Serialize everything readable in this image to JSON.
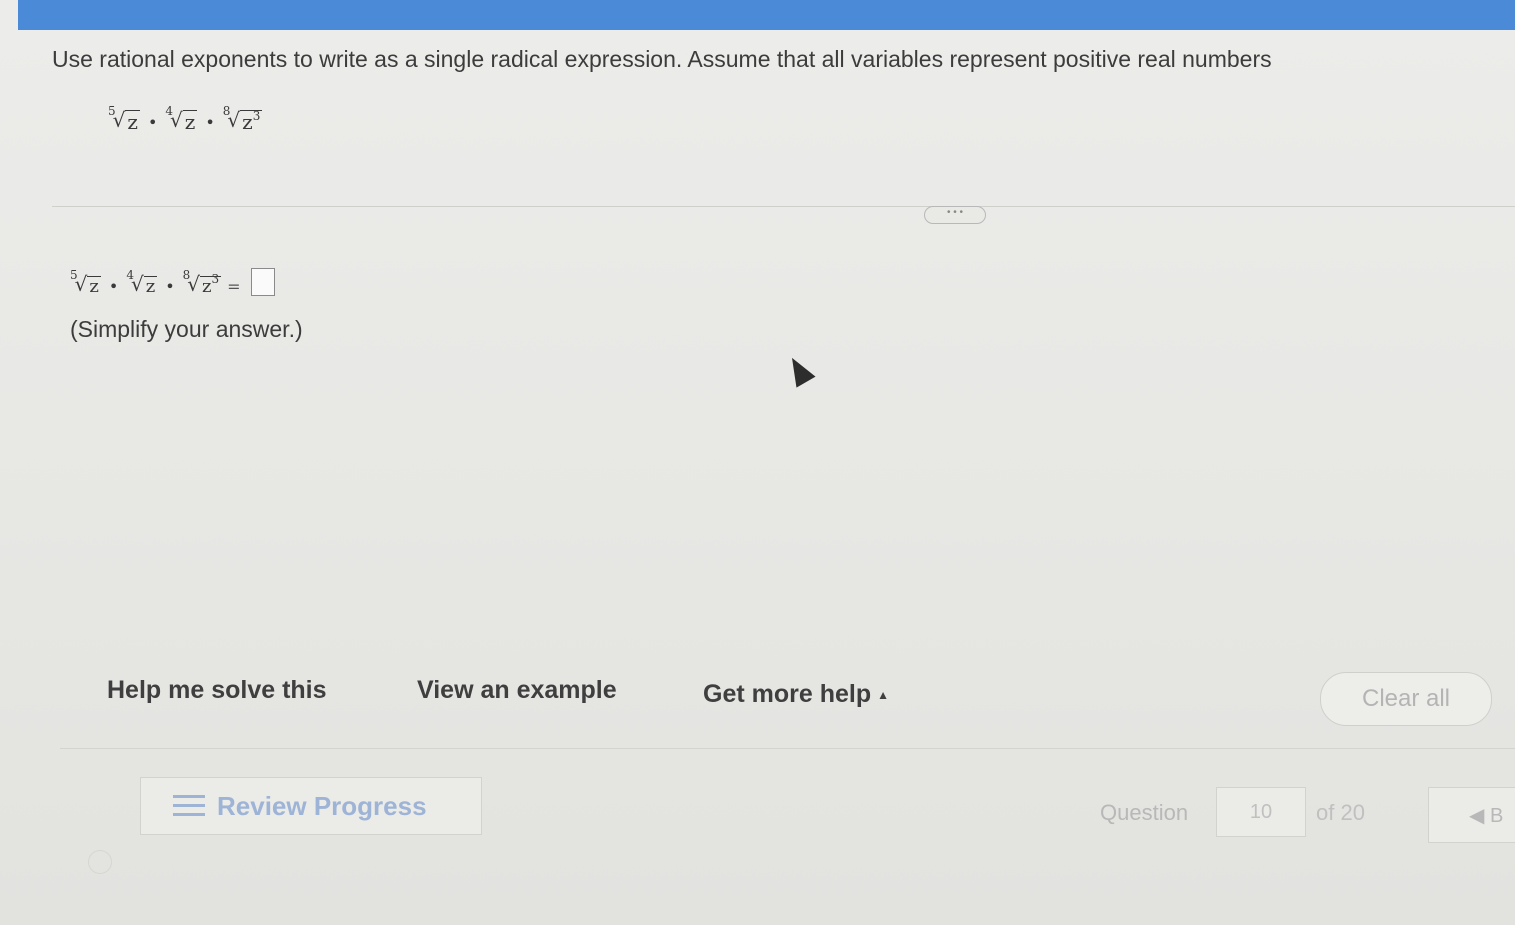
{
  "problem": {
    "instruction": "Use rational exponents to write as a single radical expression. Assume that all variables represent positive real numbers",
    "expression": [
      {
        "index": "5",
        "radicand": "z",
        "power": ""
      },
      {
        "index": "4",
        "radicand": "z",
        "power": ""
      },
      {
        "index": "8",
        "radicand": "z",
        "power": "3"
      }
    ],
    "operator": "•",
    "equals": "=",
    "hint": "(Simplify your answer.)",
    "expander": "• • •"
  },
  "actions": {
    "help_me_solve": "Help me solve this",
    "view_example": "View an example",
    "get_more_help": "Get more help",
    "get_more_help_caret": "▲",
    "clear_all": "Clear all"
  },
  "footer": {
    "review_progress": "Review Progress",
    "question_label": "Question",
    "question_number": "10",
    "question_of": "of 20",
    "nav_label": "◀ B"
  },
  "colors": {
    "topbar": "#4a8ad6",
    "review_accent": "#9eb4d6"
  }
}
